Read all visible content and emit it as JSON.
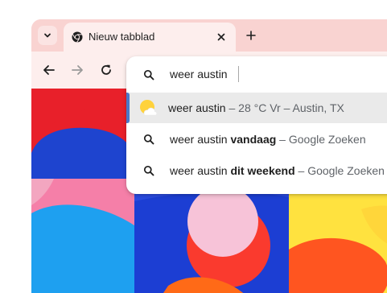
{
  "tab": {
    "title": "Nieuw tabblad",
    "favicon_icon": "chrome-icon",
    "close_icon": "close-icon"
  },
  "tab_strip": {
    "tab_search_icon": "chevron-down-icon",
    "new_tab_icon": "plus-icon"
  },
  "toolbar": {
    "back_icon": "arrow-left-icon",
    "forward_icon": "arrow-right-icon",
    "reload_icon": "reload-icon"
  },
  "omnibox": {
    "query": "weer austin",
    "search_icon": "search-icon",
    "suggestions": [
      {
        "type": "weather",
        "icon": "weather-sun-cloud-icon",
        "main": "weer austin",
        "separator": " – ",
        "extra": "28 °C Vr – Austin, TX",
        "selected": true
      },
      {
        "type": "search",
        "icon": "search-icon",
        "main": "weer austin ",
        "bold": "vandaag",
        "separator": " – ",
        "extra": "Google Zoeken",
        "selected": false
      },
      {
        "type": "search",
        "icon": "search-icon",
        "main": "weer austin ",
        "bold": "dit weekend",
        "separator": " – ",
        "extra": "Google Zoeken",
        "selected": false
      }
    ]
  },
  "colors": {
    "frame": "#f9d3d1",
    "active_tab": "#fdeeed",
    "selected_row": "#eaeaea",
    "accent": "#4a78c9"
  }
}
